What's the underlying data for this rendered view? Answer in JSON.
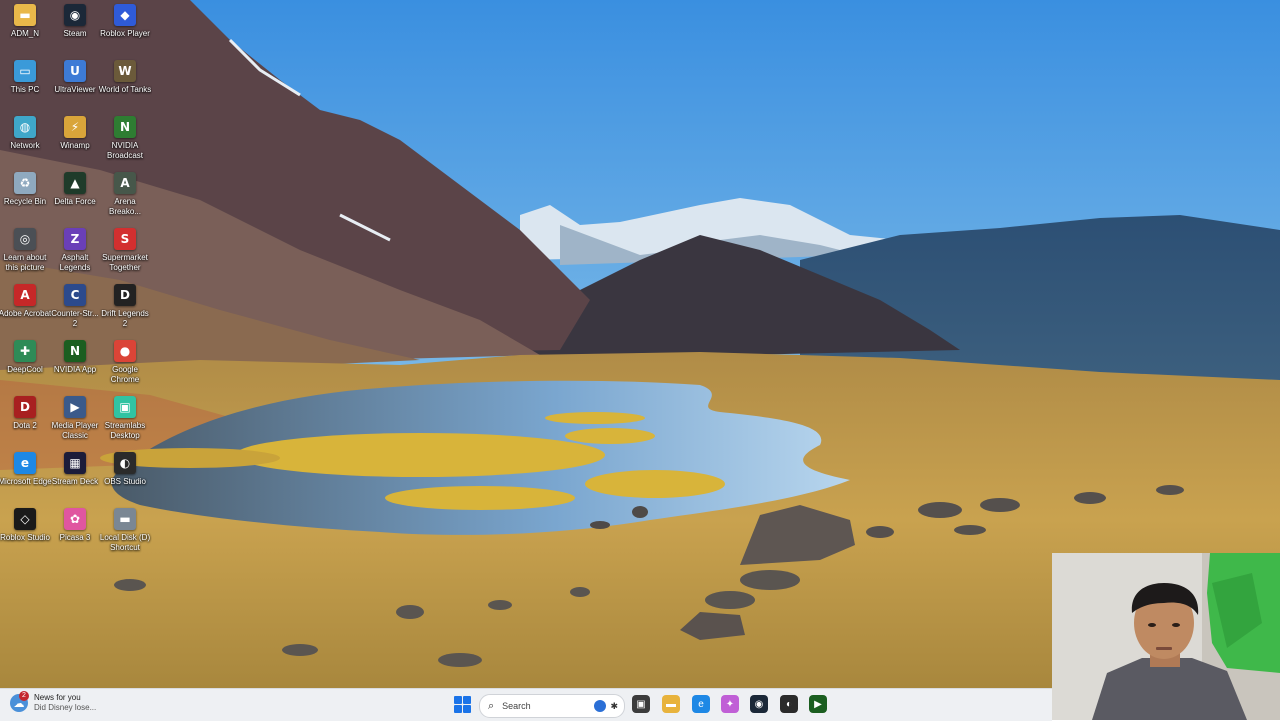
{
  "desktop": {
    "icons": [
      {
        "label": "ADM_N",
        "icon": "folder-icon",
        "color": "#e9b84a",
        "glyph": "▬"
      },
      {
        "label": "Steam",
        "icon": "steam-icon",
        "color": "#1b2838",
        "glyph": "◉"
      },
      {
        "label": "Roblox Player",
        "icon": "roblox-icon",
        "color": "#2f5bd8",
        "glyph": "◆"
      },
      {
        "label": "This PC",
        "icon": "monitor-icon",
        "color": "#3a9ad9",
        "glyph": "▭"
      },
      {
        "label": "UltraViewer",
        "icon": "ultraviewer-icon",
        "color": "#3d7bd6",
        "glyph": "U"
      },
      {
        "label": "World of Tanks",
        "icon": "tank-icon",
        "color": "#6b5a3a",
        "glyph": "W"
      },
      {
        "label": "Network",
        "icon": "network-icon",
        "color": "#3fa7c9",
        "glyph": "◍"
      },
      {
        "label": "Winamp",
        "icon": "winamp-icon",
        "color": "#d9a53a",
        "glyph": "⚡"
      },
      {
        "label": "NVIDIA Broadcast",
        "icon": "nvidia-icon",
        "color": "#2e7d32",
        "glyph": "N"
      },
      {
        "label": "Recycle Bin",
        "icon": "recycle-bin-icon",
        "color": "#8fa9bf",
        "glyph": "♻"
      },
      {
        "label": "Delta Force",
        "icon": "delta-force-icon",
        "color": "#1f3b2a",
        "glyph": "▲"
      },
      {
        "label": "Arena Breako...",
        "icon": "arena-breakout-icon",
        "color": "#47574a",
        "glyph": "A"
      },
      {
        "label": "Learn about this picture",
        "icon": "camera-icon",
        "color": "#4b4f55",
        "glyph": "◎"
      },
      {
        "label": "Asphalt Legends",
        "icon": "asphalt-icon",
        "color": "#6a3fb8",
        "glyph": "Z"
      },
      {
        "label": "Supermarket Together",
        "icon": "supermarket-icon",
        "color": "#d32f2f",
        "glyph": "S"
      },
      {
        "label": "Adobe Acrobat",
        "icon": "acrobat-icon",
        "color": "#c62828",
        "glyph": "A"
      },
      {
        "label": "Counter-Str... 2",
        "icon": "counter-strike-icon",
        "color": "#2c4a8c",
        "glyph": "C"
      },
      {
        "label": "Drift Legends 2",
        "icon": "drift-legends-icon",
        "color": "#222222",
        "glyph": "D"
      },
      {
        "label": "DeepCool",
        "icon": "deepcool-icon",
        "color": "#2e8b57",
        "glyph": "✚"
      },
      {
        "label": "NVIDIA App",
        "icon": "nvidia-app-icon",
        "color": "#1b5e20",
        "glyph": "N"
      },
      {
        "label": "Google Chrome",
        "icon": "chrome-icon",
        "color": "#db4437",
        "glyph": "●"
      },
      {
        "label": "Dota 2",
        "icon": "dota-icon",
        "color": "#a82020",
        "glyph": "D"
      },
      {
        "label": "Media Player Classic",
        "icon": "media-player-icon",
        "color": "#3b5a8a",
        "glyph": "▶"
      },
      {
        "label": "Streamlabs Desktop",
        "icon": "streamlabs-icon",
        "color": "#31c3a2",
        "glyph": "▣"
      },
      {
        "label": "Microsoft Edge",
        "icon": "edge-icon",
        "color": "#1e88e5",
        "glyph": "e"
      },
      {
        "label": "Stream Deck",
        "icon": "stream-deck-icon",
        "color": "#1c1c3a",
        "glyph": "▦"
      },
      {
        "label": "OBS Studio",
        "icon": "obs-icon",
        "color": "#2b2b2b",
        "glyph": "◐"
      },
      {
        "label": "Roblox Studio",
        "icon": "roblox-studio-icon",
        "color": "#1a1a1a",
        "glyph": "◇"
      },
      {
        "label": "Picasa 3",
        "icon": "picasa-icon",
        "color": "#e056a0",
        "glyph": "✿"
      },
      {
        "label": "Local Disk (D) Shortcut",
        "icon": "disk-icon",
        "color": "#7a8794",
        "glyph": "▬"
      }
    ]
  },
  "taskbar": {
    "news": {
      "badge": "2",
      "title": "News for you",
      "subtitle": "Did Disney lose..."
    },
    "search": {
      "placeholder": "Search"
    },
    "apps": [
      {
        "name": "task-view-icon",
        "color": "#3c3c3c",
        "glyph": "▣"
      },
      {
        "name": "file-explorer-icon",
        "color": "#e8b33c",
        "glyph": "▬"
      },
      {
        "name": "edge-taskbar-icon",
        "color": "#1e88e5",
        "glyph": "e"
      },
      {
        "name": "copilot-icon",
        "color": "#c05fd6",
        "glyph": "✦"
      },
      {
        "name": "steam-taskbar-icon",
        "color": "#1b2838",
        "glyph": "◉"
      },
      {
        "name": "obs-taskbar-icon",
        "color": "#2b2b2b",
        "glyph": "◐"
      },
      {
        "name": "nvidia-taskbar-icon",
        "color": "#1b5e20",
        "glyph": "▶"
      }
    ]
  }
}
